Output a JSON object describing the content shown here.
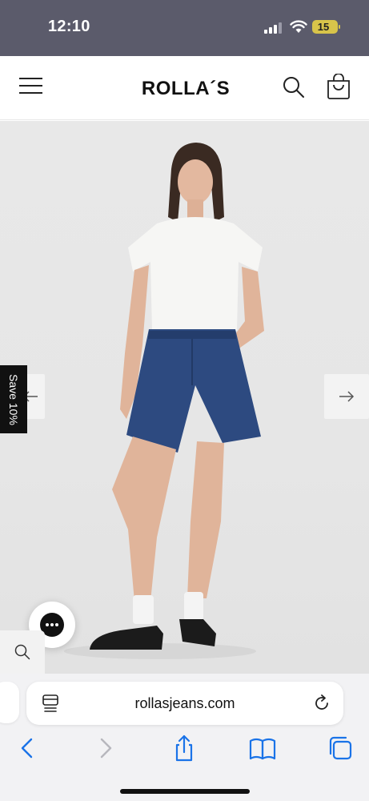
{
  "status_bar": {
    "time": "12:10",
    "battery_level": "15",
    "battery_color": "#d8c44a"
  },
  "header": {
    "brand": "ROLLA´S",
    "menu_icon": "hamburger-menu-icon",
    "search_icon": "search-icon",
    "cart_icon": "shopping-bag-icon"
  },
  "hero": {
    "save_tab_label": "Save 10%",
    "prev_icon": "arrow-left-icon",
    "next_icon": "arrow-right-icon",
    "chat_icon": "chat-ellipsis-icon",
    "search_icon": "search-icon"
  },
  "browser": {
    "url": "rollasjeans.com",
    "reader_icon": "page-menu-icon",
    "reload_icon": "reload-icon",
    "toolbar": [
      "back-icon",
      "forward-icon",
      "share-icon",
      "bookmarks-icon",
      "tabs-icon"
    ],
    "accent_color": "#1a73e8"
  }
}
